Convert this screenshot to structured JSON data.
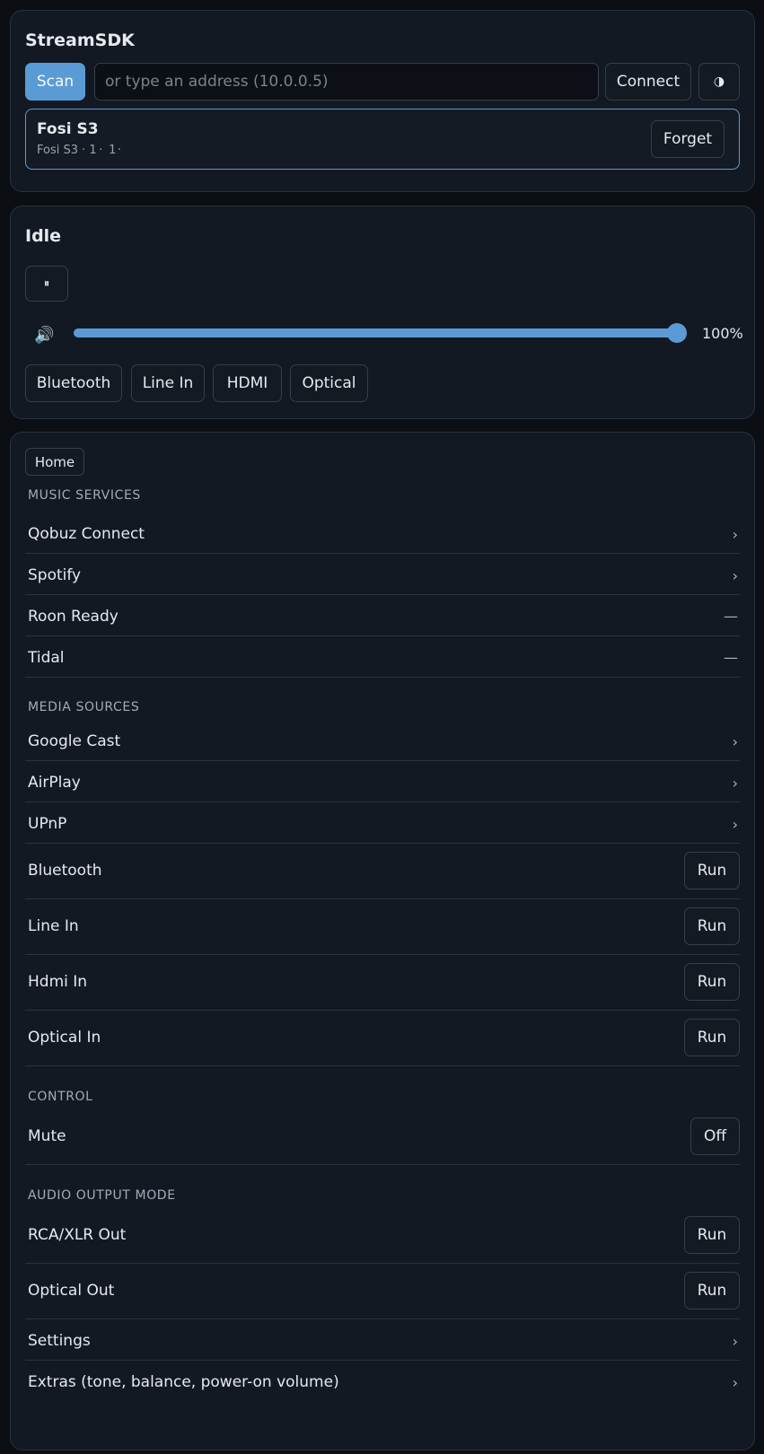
{
  "header": {
    "title": "StreamSDK",
    "scan_label": "Scan",
    "address_placeholder": "or type an address (10.0.0.5)",
    "connect_label": "Connect",
    "theme_icon": "◑",
    "device": {
      "name": "Fosi S3",
      "subtitle": "Fosi S3 · 1 ·  1 ·  ",
      "forget_label": "Forget"
    }
  },
  "player": {
    "status": "Idle",
    "pause_icon": "⏸",
    "volume_icon": "🔊",
    "volume_percent": 100,
    "volume_label": "100%",
    "sources": [
      "Bluetooth",
      "Line In",
      "HDMI",
      "Optical"
    ]
  },
  "menu": {
    "home_label": "Home",
    "sections": {
      "music": "MUSIC SERVICES",
      "media": "MEDIA SOURCES",
      "control": "CONTROL",
      "audio": "AUDIO OUTPUT MODE"
    },
    "music_items": [
      {
        "label": "Qobuz Connect",
        "trail": "›"
      },
      {
        "label": "Spotify",
        "trail": "›"
      },
      {
        "label": "Roon Ready",
        "trail": "—"
      },
      {
        "label": "Tidal",
        "trail": "—"
      }
    ],
    "media_items": [
      {
        "label": "Google Cast",
        "trail": "›"
      },
      {
        "label": "AirPlay",
        "trail": "›"
      },
      {
        "label": "UPnP",
        "trail": "›"
      },
      {
        "label": "Bluetooth",
        "action": "Run"
      },
      {
        "label": "Line In",
        "action": "Run"
      },
      {
        "label": "Hdmi In",
        "action": "Run"
      },
      {
        "label": "Optical In",
        "action": "Run"
      }
    ],
    "control_items": [
      {
        "label": "Mute",
        "action": "Off"
      }
    ],
    "audio_items": [
      {
        "label": "RCA/XLR Out",
        "action": "Run"
      },
      {
        "label": "Optical Out",
        "action": "Run"
      }
    ],
    "bottom_items": [
      {
        "label": "Settings",
        "trail": "›"
      },
      {
        "label": "Extras (tone, balance, power-on volume)",
        "trail": "›"
      }
    ]
  },
  "colors": {
    "accent": "#5b9bd5",
    "background": "#0b0e13",
    "card": "#131922",
    "border": "#2a323d"
  }
}
